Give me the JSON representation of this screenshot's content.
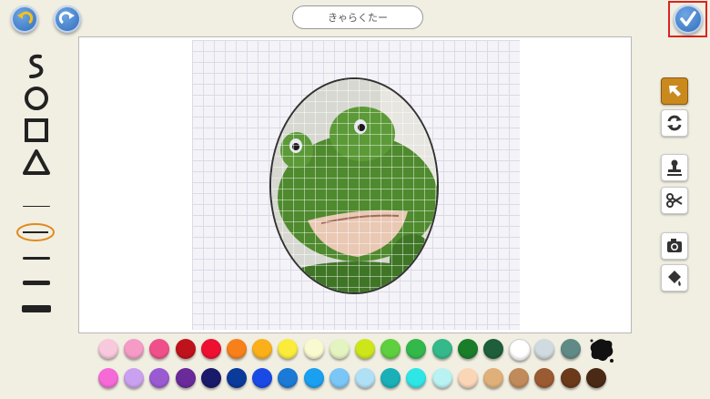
{
  "header": {
    "title": "きゃらくたー",
    "undo_icon": "undo-arrow-icon",
    "redo_icon": "redo-arrow-icon",
    "done_icon": "checkmark-icon"
  },
  "left_tools": {
    "shapes": [
      "freehand-squiggle-icon",
      "circle-shape-icon",
      "square-shape-icon",
      "triangle-shape-icon"
    ],
    "line_widths": [
      "thin",
      "medium-selected",
      "medium-thick",
      "thick"
    ],
    "selection_color": "#e08a1e"
  },
  "right_tools": [
    "select-arrow-icon",
    "rotate-icon",
    "stamp-icon",
    "scissors-icon",
    "camera-icon",
    "paint-bucket-icon"
  ],
  "palette": {
    "row1": [
      "#f8c8dc",
      "#f59bc6",
      "#f0508a",
      "#c0121c",
      "#ee1030",
      "#f7801a",
      "#fbb01a",
      "#fbeb3a",
      "#fafad0",
      "#e4f4c0",
      "#cde61a",
      "#5ecf3e",
      "#33b84a",
      "#33b98a",
      "#1a7d2a",
      "#1e5e3a",
      "#ffffff",
      "#cfdbe0",
      "#5f8a86"
    ],
    "row2": [
      "#f56ad6",
      "#caa0f0",
      "#9a5ad2",
      "#6a2a9a",
      "#1a1a6a",
      "#0a3a9a",
      "#1a4ae6",
      "#1a7ad6",
      "#1aa0f0",
      "#7ac6f6",
      "#b0e0f6",
      "#1ab0b8",
      "#2ee6e6",
      "#b8f2f2",
      "#fad6b6",
      "#e0b07a",
      "#c08a5a",
      "#9a5a32",
      "#6a3a1a",
      "#4a2a14"
    ],
    "ink_blot_icon": "ink-blot-icon"
  },
  "colors": {
    "background": "#f1eee2",
    "blue_button": "#2b68b7",
    "done_highlight": "#d9251d",
    "active_tool": "#c9891c"
  }
}
